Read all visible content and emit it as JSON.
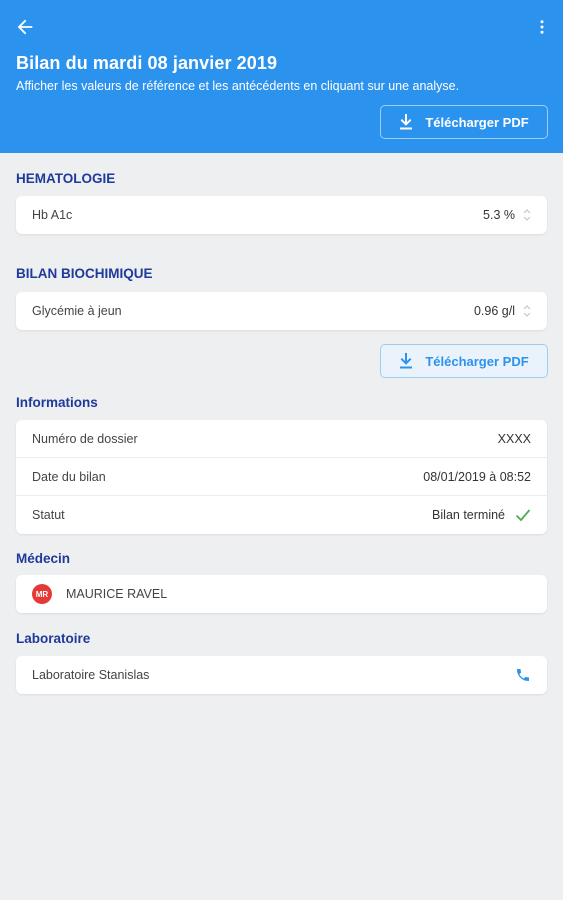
{
  "header": {
    "title": "Bilan du mardi 08 janvier 2019",
    "subtitle": "Afficher les valeurs de référence et les antécédents en cliquant sur une analyse.",
    "pdf_label": "Télécharger PDF"
  },
  "sections": {
    "hematologie": {
      "title": "HEMATOLOGIE",
      "rows": [
        {
          "label": "Hb A1c",
          "value": "5.3 %"
        }
      ]
    },
    "biochimie": {
      "title": "BILAN BIOCHIMIQUE",
      "rows": [
        {
          "label": "Glycémie à jeun",
          "value": "0.96 g/l"
        }
      ]
    },
    "pdf_label": "Télécharger PDF",
    "informations": {
      "title": "Informations",
      "rows": [
        {
          "label": "Numéro de dossier",
          "value": "XXXX"
        },
        {
          "label": "Date du bilan",
          "value": "08/01/2019 à 08:52"
        },
        {
          "label": "Statut",
          "value": "Bilan terminé"
        }
      ]
    },
    "medecin": {
      "title": "Médecin",
      "avatar": "MR",
      "name": "MAURICE RAVEL"
    },
    "laboratoire": {
      "title": "Laboratoire",
      "name": "Laboratoire Stanislas"
    }
  },
  "colors": {
    "primary": "#2b93ee",
    "section_title": "#1e3a9a",
    "status_ok": "#4caf50",
    "avatar": "#e53935"
  },
  "icons": [
    "arrow-back-icon",
    "more-vert-icon",
    "download-icon",
    "chevron-updown-icon",
    "check-icon",
    "phone-icon"
  ]
}
